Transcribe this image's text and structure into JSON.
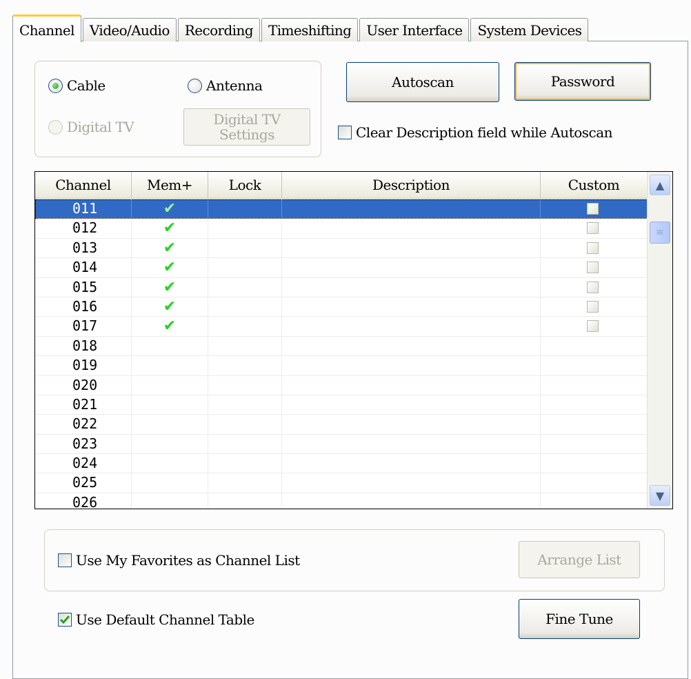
{
  "tabs": [
    {
      "label": "Channel",
      "active": true
    },
    {
      "label": "Video/Audio"
    },
    {
      "label": "Recording"
    },
    {
      "label": "Timeshifting"
    },
    {
      "label": "User Interface"
    },
    {
      "label": "System Devices"
    }
  ],
  "source": {
    "cable": "Cable",
    "antenna": "Antenna",
    "digital_tv": "Digital TV",
    "digital_settings_line1": "Digital TV",
    "digital_settings_line2": "Settings",
    "selected": "Cable"
  },
  "buttons": {
    "autoscan": "Autoscan",
    "password": "Password",
    "arrange_list": "Arrange List",
    "fine_tune": "Fine Tune"
  },
  "options": {
    "clear_description": "Clear Description field while Autoscan",
    "clear_description_checked": false,
    "use_favorites": "Use My Favorites as Channel List",
    "use_favorites_checked": false,
    "use_default_table": "Use Default Channel Table",
    "use_default_table_checked": true
  },
  "channel_table": {
    "columns": [
      "Channel",
      "Mem+",
      "Lock",
      "Description",
      "Custom"
    ],
    "rows": [
      {
        "channel": "011",
        "mem": true,
        "custom_box": true,
        "selected": true
      },
      {
        "channel": "012",
        "mem": true,
        "custom_box": true
      },
      {
        "channel": "013",
        "mem": true,
        "custom_box": true
      },
      {
        "channel": "014",
        "mem": true,
        "custom_box": true
      },
      {
        "channel": "015",
        "mem": true,
        "custom_box": true
      },
      {
        "channel": "016",
        "mem": true,
        "custom_box": true
      },
      {
        "channel": "017",
        "mem": true,
        "custom_box": true
      },
      {
        "channel": "018"
      },
      {
        "channel": "019"
      },
      {
        "channel": "020"
      },
      {
        "channel": "021"
      },
      {
        "channel": "022"
      },
      {
        "channel": "023"
      },
      {
        "channel": "024"
      },
      {
        "channel": "025"
      },
      {
        "channel": "026"
      }
    ]
  },
  "icons": {
    "check": "✔",
    "scroll_up": "▲",
    "scroll_down": "▼",
    "grip": "≡"
  },
  "colors": {
    "selection": "#316ac5",
    "check_green": "#22d422",
    "focus_orange": "#f8b330"
  }
}
